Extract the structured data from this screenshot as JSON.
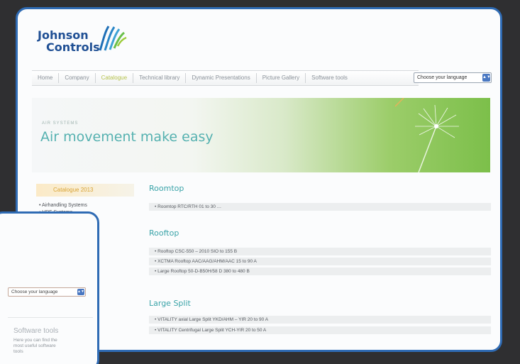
{
  "brand": {
    "line1": "Johnson",
    "line2": "Controls",
    "colors": {
      "primary": "#1f4f94",
      "accent": "#4eb6d3",
      "highlight": "#b6c24c"
    }
  },
  "nav": {
    "items": [
      "Home",
      "Company",
      "Catalogue",
      "Technical library",
      "Dynamic Presentations",
      "Picture Gallery",
      "Software tools"
    ],
    "active": "Catalogue"
  },
  "language_select": {
    "value": "Choose your language"
  },
  "banner": {
    "kicker": "AIR SYSTEMS",
    "title": "Air movement make easy"
  },
  "sidebar": {
    "heading": "Catalogue 2013",
    "items": [
      "• Airhandling Systems",
      "• VRF Systems"
    ]
  },
  "sections": [
    {
      "title": "Roomtop",
      "items": [
        "• Roomtop RTC/RTH 01 to 30 …"
      ]
    },
    {
      "title": "Rooftop",
      "items": [
        "• Rooftop CSC-550 – 2010 SIO to 155 B",
        "• XCTMA Rooftop AAC/AAG/AHM/AAC 15 to 90 A",
        "• Large Rooftop 50-D-B50H/58 D 380 to 480 B"
      ]
    },
    {
      "title": "Large Split",
      "items": [
        "• VITALITY axial Large Split YKD/AHM – YIR 20 to 90 A",
        "• VITALITY Centrifugal Large Split YCH-YIR 20 to 50 A"
      ]
    }
  ],
  "overlay": {
    "language_select": "Choose your language",
    "tools_title": "Software tools",
    "tools_desc": "Here you can find the most useful software tools"
  }
}
